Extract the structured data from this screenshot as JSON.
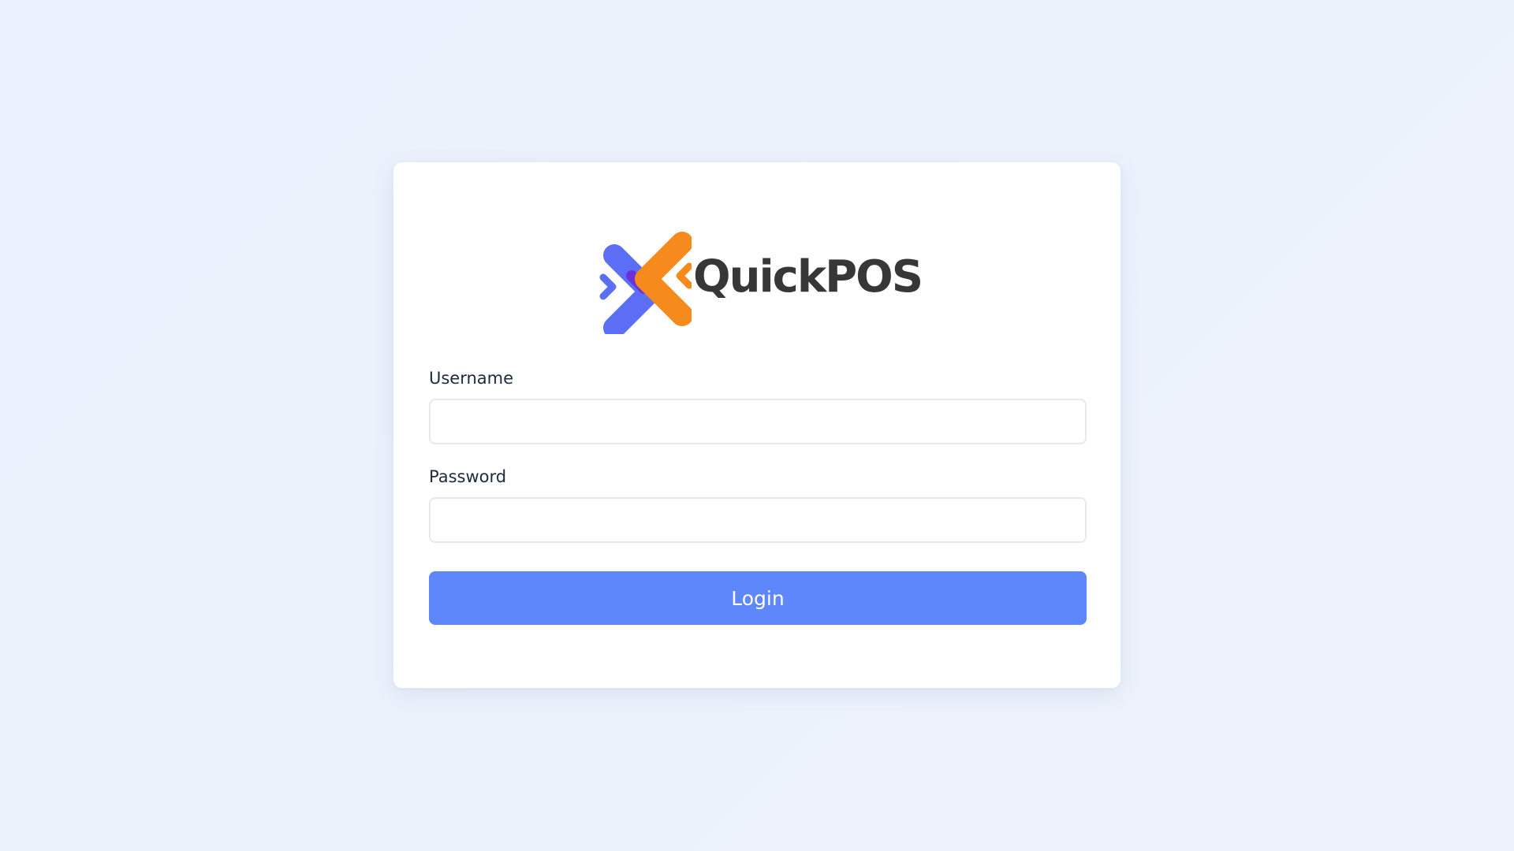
{
  "logo": {
    "icon": "quickpos-logo-icon",
    "text": "QuickPOS",
    "colors": {
      "blue": "#5b6ef5",
      "orange": "#f68a1c",
      "purple": "#6a31d9",
      "text": "#373737"
    }
  },
  "form": {
    "username_label": "Username",
    "username_value": "",
    "password_label": "Password",
    "password_value": "",
    "login_label": "Login",
    "login_color": "#5e87fb"
  }
}
